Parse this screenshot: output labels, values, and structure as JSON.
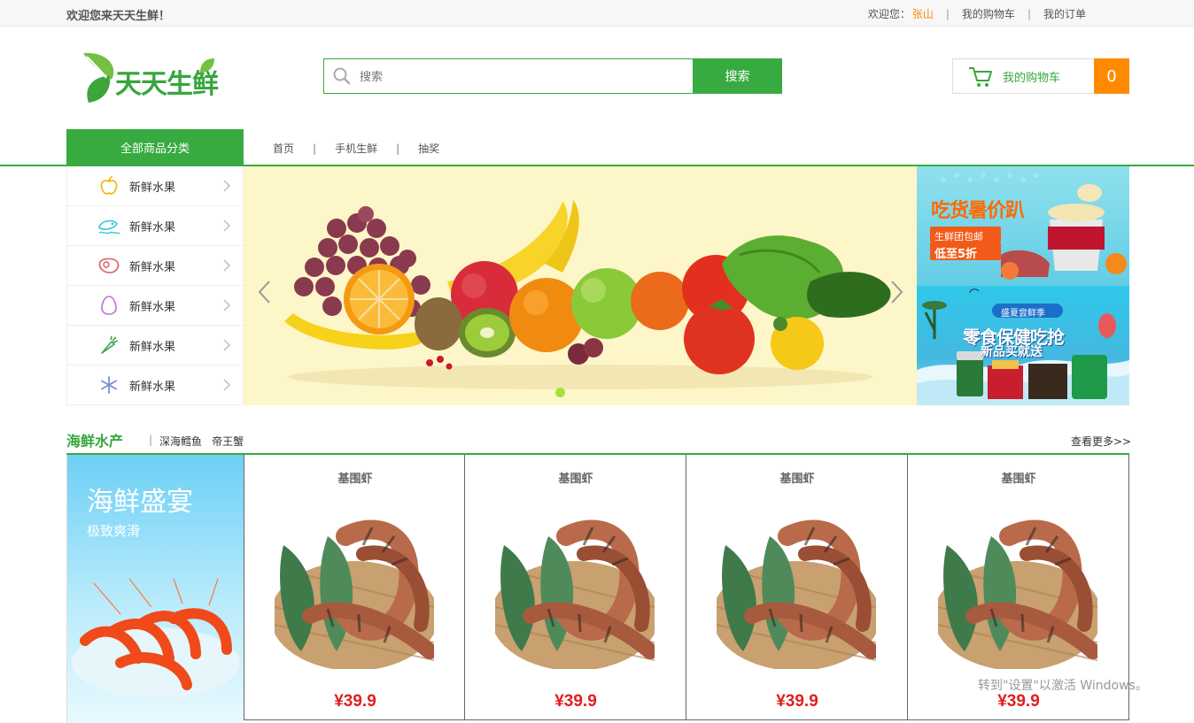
{
  "topbar": {
    "welcome": "欢迎您来天天生鲜！",
    "greeting": "欢迎您：",
    "username": "张山",
    "cart_link": "我的购物车",
    "orders_link": "我的订单"
  },
  "header": {
    "logo_text": "天天生鲜",
    "search_placeholder": "搜索",
    "search_button": "搜索",
    "cart_label": "我的购物车",
    "cart_count": "0"
  },
  "nav": {
    "all_categories": "全部商品分类",
    "links": [
      "首页",
      "手机生鲜",
      "抽奖"
    ]
  },
  "sidebar": {
    "items": [
      {
        "label": "新鲜水果",
        "icon": "apple-icon"
      },
      {
        "label": "新鲜水果",
        "icon": "seafood-icon"
      },
      {
        "label": "新鲜水果",
        "icon": "meat-icon"
      },
      {
        "label": "新鲜水果",
        "icon": "egg-icon"
      },
      {
        "label": "新鲜水果",
        "icon": "carrot-icon"
      },
      {
        "label": "新鲜水果",
        "icon": "snowflake-icon"
      }
    ]
  },
  "ads": {
    "ad1_title": "吃货暑价趴",
    "ad1_line1": "生鲜团包邮",
    "ad1_line2": "低至5折",
    "ad2_tag": "盛夏尝鲜季",
    "ad2_title": "零食保健吃抢",
    "ad2_sub": "新品买就送"
  },
  "section": {
    "title": "海鲜水产",
    "tags": [
      "深海鳕鱼",
      "帝王蟹"
    ],
    "more": "查看更多>>",
    "promo_title": "海鲜盛宴",
    "promo_sub": "极致爽滑",
    "products": [
      {
        "name": "基围虾",
        "price": "¥39.9"
      },
      {
        "name": "基围虾",
        "price": "¥39.9"
      },
      {
        "name": "基围虾",
        "price": "¥39.9"
      },
      {
        "name": "基围虾",
        "price": "¥39.9"
      }
    ]
  },
  "watermark": {
    "line2": "转到\"设置\"以激活 Windows。"
  },
  "colors": {
    "brand_green": "#37ab40",
    "cart_orange": "#ff8a00",
    "price_red": "#e21e1e"
  }
}
